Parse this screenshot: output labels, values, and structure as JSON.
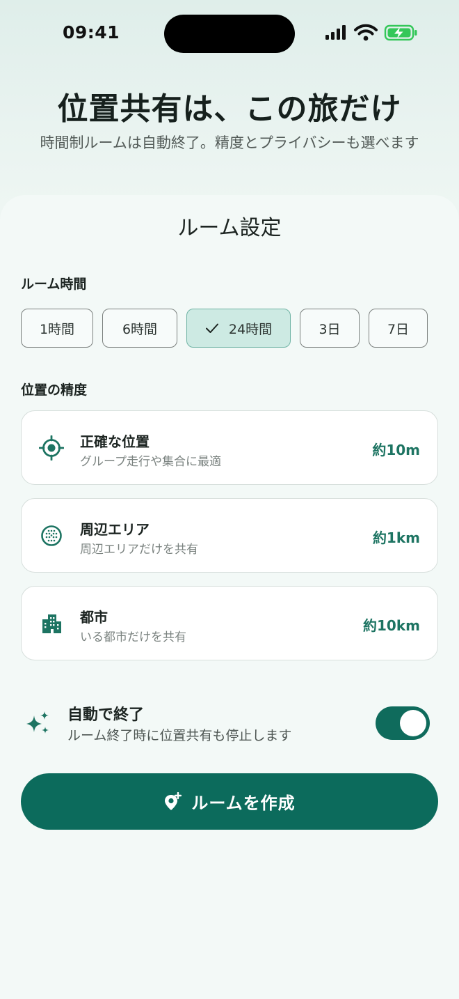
{
  "status_bar": {
    "time": "09:41"
  },
  "header": {
    "title": "位置共有は、この旅だけ",
    "subtitle": "時間制ルームは自動終了。精度とプライバシーも選べます"
  },
  "sheet": {
    "title": "ルーム設定",
    "duration": {
      "label": "ルーム時間",
      "options": [
        "1時間",
        "6時間",
        "24時間",
        "3日",
        "7日"
      ],
      "selected": "24時間"
    },
    "precision": {
      "label": "位置の精度",
      "options": [
        {
          "title": "正確な位置",
          "desc": "グループ走行や集合に最適",
          "value": "約10m",
          "icon": "crosshair-icon"
        },
        {
          "title": "周辺エリア",
          "desc": "周辺エリアだけを共有",
          "value": "約1km",
          "icon": "area-grid-icon"
        },
        {
          "title": "都市",
          "desc": "いる都市だけを共有",
          "value": "約10km",
          "icon": "city-icon"
        }
      ]
    },
    "auto_end": {
      "title": "自動で終了",
      "desc": "ルーム終了時に位置共有も停止します",
      "enabled": true
    },
    "create_button": {
      "label": "ルームを作成"
    }
  },
  "colors": {
    "accent": "#0c6b5c",
    "accent_light": "#cdeae3",
    "value_text": "#1d7462"
  }
}
